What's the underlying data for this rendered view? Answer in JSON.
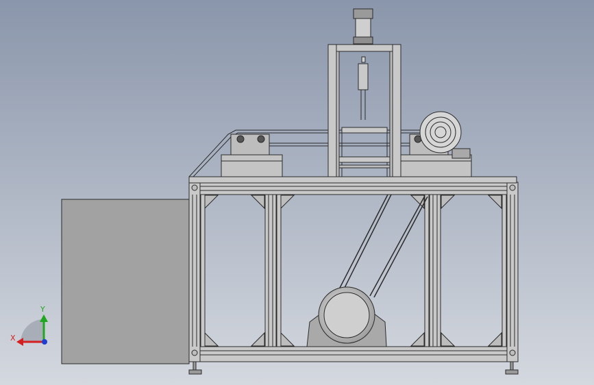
{
  "viewport": {
    "background_top": "#8a96ab",
    "background_bottom": "#d4d8df"
  },
  "triad": {
    "x_label": "X",
    "y_label": "Y",
    "x_color": "#d42020",
    "y_color": "#1fa81f",
    "z_color": "#1f3fd4"
  },
  "model": {
    "frame_color": "#c9c9c9",
    "panel_color": "#a2a2a2",
    "line_color": "#2a2a2a",
    "pulley_color": "#d8d8d8"
  }
}
